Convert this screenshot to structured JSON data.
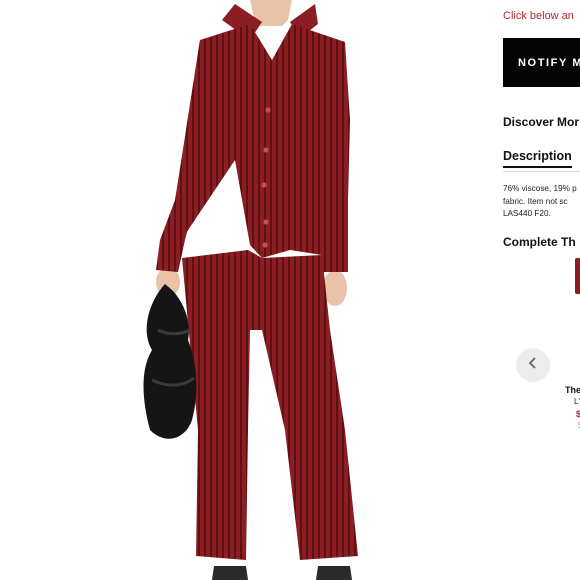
{
  "photo": {
    "subject": "model in burgundy ribbed button-up shirt and flared pants holding black bag",
    "outfit_color": "#8a1e23",
    "bag_color": "#151515"
  },
  "panel": {
    "notice": "Click below an",
    "notify_button": "NOTIFY M",
    "discover": "Discover Mor",
    "description_tab": "Description",
    "description_lines": [
      "76% viscose, 19% p",
      "fabric. Item not sc",
      "LAS440 F20."
    ],
    "complete_heading": "Complete Th",
    "carousel": {
      "prev_icon": "chevron-left-icon",
      "brand": "The",
      "name": "L'",
      "price": "$",
      "old_price": "$"
    }
  },
  "colors": {
    "accent_red": "#b8282e",
    "button_black": "#050505",
    "arrow_bg": "#ececec"
  }
}
